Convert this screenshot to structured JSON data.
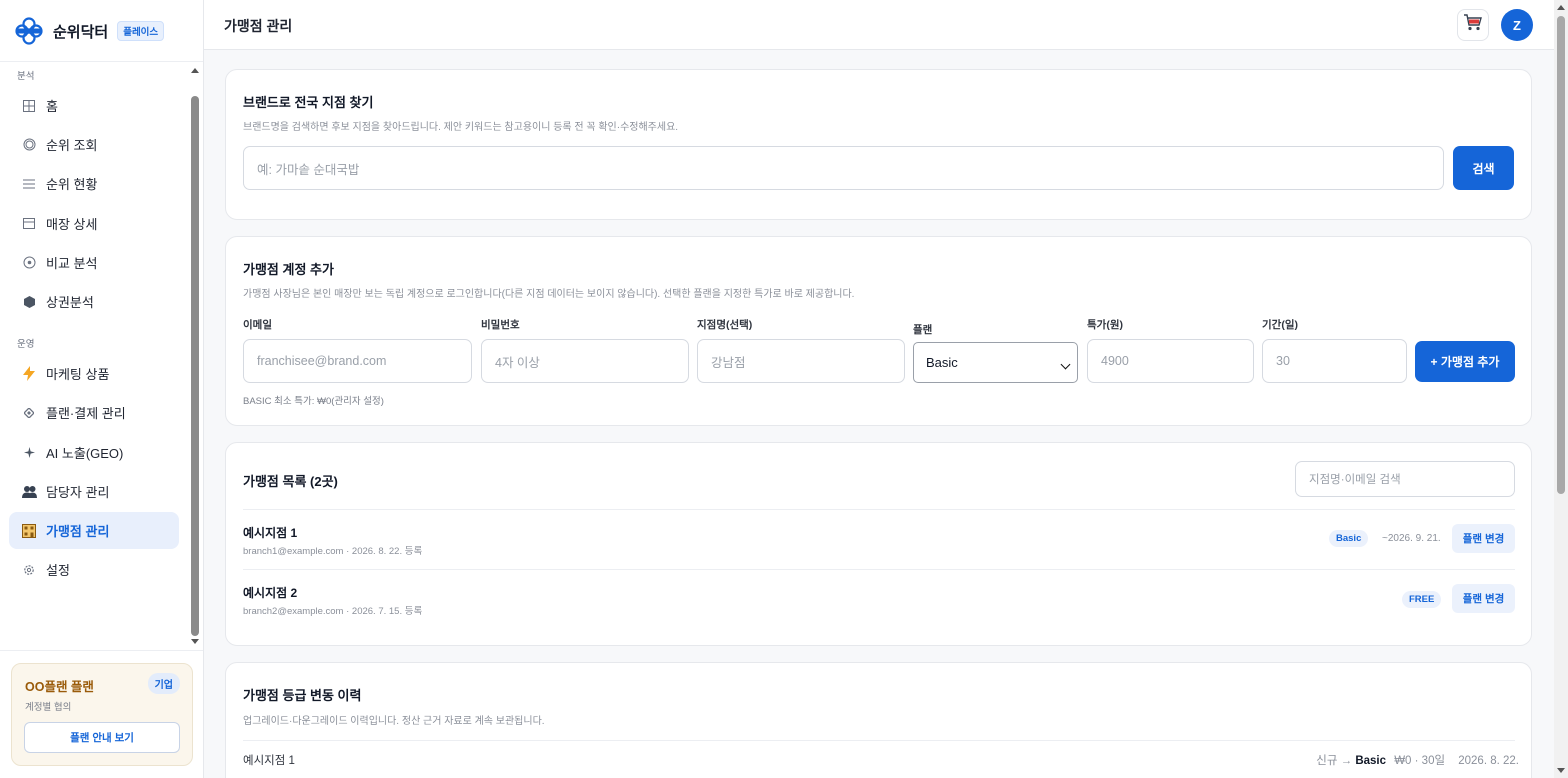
{
  "brand": {
    "name": "순위닥터",
    "badge": "플레이스"
  },
  "sidebar": {
    "sections": [
      {
        "label": "분석"
      },
      {
        "label": "운영"
      }
    ],
    "items": [
      {
        "label": "홈",
        "icon": "grid-icon"
      },
      {
        "label": "순위 조회",
        "icon": "circle-icon"
      },
      {
        "label": "순위 현황",
        "icon": "list-icon"
      },
      {
        "label": "매장 상세",
        "icon": "store-icon"
      },
      {
        "label": "비교 분석",
        "icon": "compare-icon"
      },
      {
        "label": "상권분석",
        "icon": "hexagon-icon"
      },
      {
        "label": "마케팅 상품",
        "icon": "lightning-icon"
      },
      {
        "label": "플랜·결제 관리",
        "icon": "diamond-icon"
      },
      {
        "label": "AI 노출(GEO)",
        "icon": "sparkle-icon"
      },
      {
        "label": "담당자 관리",
        "icon": "people-icon"
      },
      {
        "label": "가맹점 관리",
        "icon": "building-icon",
        "active": true
      },
      {
        "label": "설정",
        "icon": "gear-icon"
      }
    ],
    "plan": {
      "name": "OO플랜 플랜",
      "tag": "기업",
      "sub": "계정별 협의",
      "button": "플랜 안내 보기"
    }
  },
  "header": {
    "title": "가맹점 관리",
    "avatar": "Z"
  },
  "brand_search": {
    "title": "브랜드로 전국 지점 찾기",
    "desc": "브랜드명을 검색하면 후보 지점을 찾아드립니다. 제안 키워드는 참고용이니 등록 전 꼭 확인·수정해주세요.",
    "placeholder": "예: 가마솥 순대국밥",
    "button": "검색"
  },
  "add_account": {
    "title": "가맹점 계정 추가",
    "desc": "가맹점 사장님은 본인 매장만 보는 독립 계정으로 로그인합니다(다른 지점 데이터는 보이지 않습니다). 선택한 플랜을 지정한 특가로 바로 제공합니다.",
    "fields": {
      "email": {
        "label": "이메일",
        "placeholder": "franchisee@brand.com"
      },
      "password": {
        "label": "비밀번호",
        "placeholder": "4자 이상"
      },
      "branch": {
        "label": "지점명(선택)",
        "placeholder": "강남점"
      },
      "plan": {
        "label": "플랜",
        "value": "Basic"
      },
      "price": {
        "label": "특가(원)",
        "placeholder": "4900"
      },
      "period": {
        "label": "기간(일)",
        "placeholder": "30"
      }
    },
    "button": "+ 가맹점 추가",
    "hint": "BASIC 최소 특가: ₩0(관리자 설정)"
  },
  "branch_list": {
    "title": "가맹점 목록 (2곳)",
    "search_placeholder": "지점명·이메일 검색",
    "rows": [
      {
        "name": "예시지점 1",
        "sub": "branch1@example.com · 2026. 8. 22. 등록",
        "plan": "Basic",
        "until": "~2026. 9. 21.",
        "button": "플랜 변경"
      },
      {
        "name": "예시지점 2",
        "sub": "branch2@example.com · 2026. 7. 15. 등록",
        "plan": "FREE",
        "until": "",
        "button": "플랜 변경"
      }
    ]
  },
  "history": {
    "title": "가맹점 등급 변동 이력",
    "desc": "업그레이드·다운그레이드 이력입니다. 정산 근거 자료로 계속 보관됩니다.",
    "rows": [
      {
        "name": "예시지점 1",
        "from": "신규",
        "arrow": "→",
        "to": "Basic",
        "detail": "₩0 · 30일",
        "date": "2026. 8. 22."
      }
    ]
  },
  "colors": {
    "accent": "#1565d8",
    "plan_text": "#9a5b0a"
  }
}
